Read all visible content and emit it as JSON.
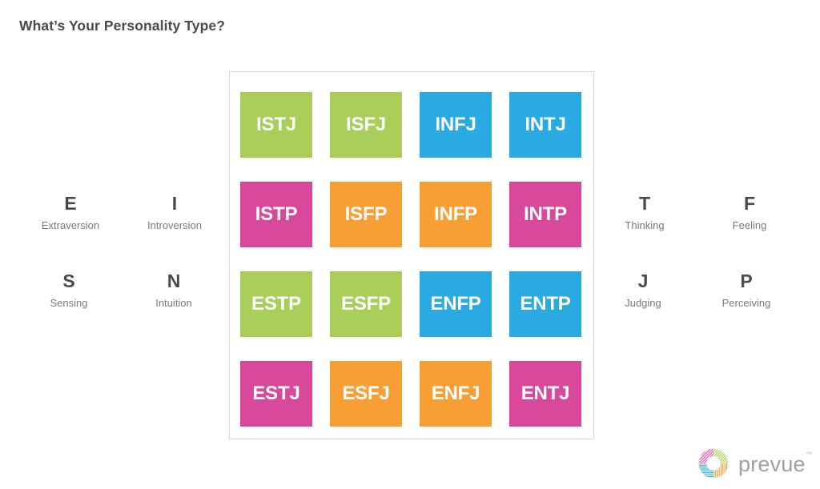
{
  "header": {
    "title": "What’s Your Personality Type?"
  },
  "colors": {
    "green": "#a9ce59",
    "blue": "#29abe2",
    "pink": "#d9499b",
    "orange": "#f79f34",
    "title_text": "#4a4a4a",
    "label_text": "#7b7b7b",
    "panel_border": "#d8d8d8",
    "logo_text": "#a0a0a0",
    "background": "#ffffff"
  },
  "grid": {
    "rows": [
      [
        {
          "code": "ISTJ",
          "color": "#a9ce59"
        },
        {
          "code": "ISFJ",
          "color": "#a9ce59"
        },
        {
          "code": "INFJ",
          "color": "#29abe2"
        },
        {
          "code": "INTJ",
          "color": "#29abe2"
        }
      ],
      [
        {
          "code": "ISTP",
          "color": "#d9499b"
        },
        {
          "code": "ISFP",
          "color": "#f79f34"
        },
        {
          "code": "INFP",
          "color": "#f79f34"
        },
        {
          "code": "INTP",
          "color": "#d9499b"
        }
      ],
      [
        {
          "code": "ESTP",
          "color": "#a9ce59"
        },
        {
          "code": "ESFP",
          "color": "#a9ce59"
        },
        {
          "code": "ENFP",
          "color": "#29abe2"
        },
        {
          "code": "ENTP",
          "color": "#29abe2"
        }
      ],
      [
        {
          "code": "ESTJ",
          "color": "#d9499b"
        },
        {
          "code": "ESFJ",
          "color": "#f79f34"
        },
        {
          "code": "ENFJ",
          "color": "#f79f34"
        },
        {
          "code": "ENTJ",
          "color": "#d9499b"
        }
      ]
    ]
  },
  "dichotomies": {
    "left": [
      {
        "letter": "E",
        "word": "Extraversion"
      },
      {
        "letter": "I",
        "word": "Introversion"
      },
      {
        "letter": "S",
        "word": "Sensing"
      },
      {
        "letter": "N",
        "word": "Intuition"
      }
    ],
    "right": [
      {
        "letter": "T",
        "word": "Thinking"
      },
      {
        "letter": "F",
        "word": "Feeling"
      },
      {
        "letter": "J",
        "word": "Judging"
      },
      {
        "letter": "P",
        "word": "Perceiving"
      }
    ]
  },
  "logo": {
    "name": "prevue",
    "trademark": "™",
    "mark_icon": "prevue-ring-icon"
  }
}
